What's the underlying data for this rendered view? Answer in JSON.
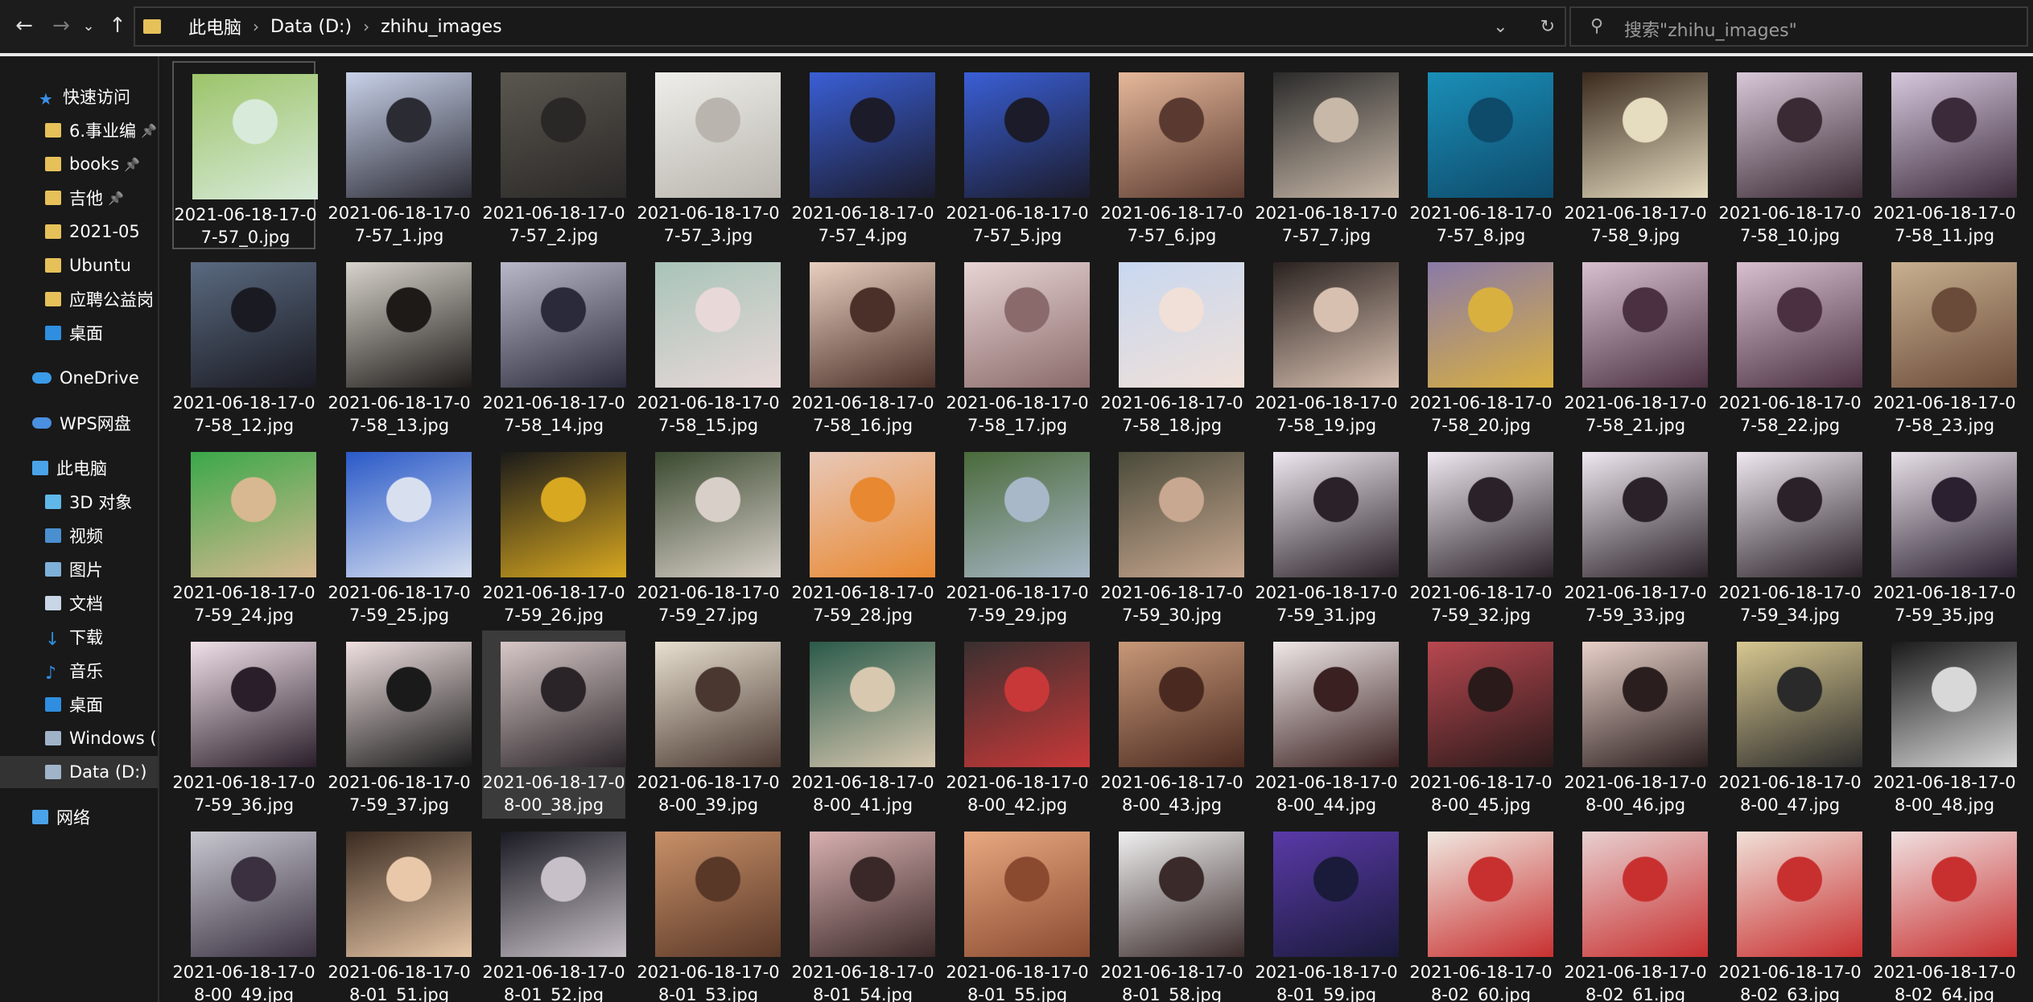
{
  "nav": {
    "back_icon": "arrow-left-icon",
    "forward_icon": "arrow-right-icon",
    "recent_icon": "chevron-down-icon",
    "up_icon": "arrow-up-icon"
  },
  "address": {
    "crumbs": [
      "此电脑",
      "Data (D:)",
      "zhihu_images"
    ],
    "dropdown_icon": "chevron-down-icon",
    "refresh_icon": "refresh-icon"
  },
  "search": {
    "placeholder": "搜索\"zhihu_images\"",
    "icon": "search-icon"
  },
  "sidebar": {
    "items": [
      {
        "label": "快速访问",
        "icon": "star-icon",
        "color": "#3a8ee6",
        "indent": 48,
        "pin": false
      },
      {
        "label": "6.事业编",
        "icon": "folder-icon",
        "color": "#e6c15a",
        "indent": 56,
        "pin": true
      },
      {
        "label": "books",
        "icon": "folder-icon",
        "color": "#e6c15a",
        "indent": 56,
        "pin": true
      },
      {
        "label": "吉他",
        "icon": "folder-icon",
        "color": "#e6c15a",
        "indent": 56,
        "pin": true
      },
      {
        "label": "2021-05",
        "icon": "folder-icon",
        "color": "#e6c15a",
        "indent": 56,
        "pin": false
      },
      {
        "label": "Ubuntu",
        "icon": "folder-icon",
        "color": "#e6c15a",
        "indent": 56,
        "pin": false
      },
      {
        "label": "应聘公益岗",
        "icon": "folder-icon",
        "color": "#e6c15a",
        "indent": 56,
        "pin": false
      },
      {
        "label": "桌面",
        "icon": "desktop-icon",
        "color": "#2f8ee0",
        "indent": 56,
        "pin": false
      },
      {
        "label": "OneDrive",
        "icon": "cloud-icon",
        "color": "#3a9be8",
        "indent": 40,
        "pin": false
      },
      {
        "label": "WPS网盘",
        "icon": "cloud-icon",
        "color": "#4a8fe0",
        "indent": 40,
        "pin": false
      },
      {
        "label": "此电脑",
        "icon": "computer-icon",
        "color": "#4aa3e8",
        "indent": 40,
        "pin": false
      },
      {
        "label": "3D 对象",
        "icon": "cube-icon",
        "color": "#5fb8e8",
        "indent": 56,
        "pin": false
      },
      {
        "label": "视频",
        "icon": "video-icon",
        "color": "#4a8fd0",
        "indent": 56,
        "pin": false
      },
      {
        "label": "图片",
        "icon": "picture-icon",
        "color": "#7fb0d8",
        "indent": 56,
        "pin": false
      },
      {
        "label": "文档",
        "icon": "document-icon",
        "color": "#c8d6e6",
        "indent": 56,
        "pin": false
      },
      {
        "label": "下载",
        "icon": "download-icon",
        "color": "#2f8ee0",
        "indent": 56,
        "pin": false
      },
      {
        "label": "音乐",
        "icon": "music-icon",
        "color": "#2f8ee0",
        "indent": 56,
        "pin": false
      },
      {
        "label": "桌面",
        "icon": "desktop-icon",
        "color": "#2f8ee0",
        "indent": 56,
        "pin": false
      },
      {
        "label": "Windows (",
        "icon": "drive-icon",
        "color": "#9fb4c8",
        "indent": 56,
        "pin": false
      },
      {
        "label": "Data (D:)",
        "icon": "drive-icon",
        "color": "#9fb4c8",
        "indent": 56,
        "pin": false
      },
      {
        "label": "网络",
        "icon": "network-icon",
        "color": "#4aa3e8",
        "indent": 40,
        "pin": false
      }
    ]
  },
  "files": [
    {
      "name": "2021-06-18-17-07-57_0.jpg",
      "c1": "#9cc46a",
      "c2": "#d8ead9"
    },
    {
      "name": "2021-06-18-17-07-57_1.jpg",
      "c1": "#c9d2ea",
      "c2": "#2b2b34"
    },
    {
      "name": "2021-06-18-17-07-57_2.jpg",
      "c1": "#5a5750",
      "c2": "#2a2826"
    },
    {
      "name": "2021-06-18-17-07-57_3.jpg",
      "c1": "#eeeeea",
      "c2": "#b9b5ae"
    },
    {
      "name": "2021-06-18-17-07-57_4.jpg",
      "c1": "#3a5fd6",
      "c2": "#1b1b2a"
    },
    {
      "name": "2021-06-18-17-07-57_5.jpg",
      "c1": "#3a5fd6",
      "c2": "#1b1b2a"
    },
    {
      "name": "2021-06-18-17-07-57_6.jpg",
      "c1": "#e6b89a",
      "c2": "#5a3a30"
    },
    {
      "name": "2021-06-18-17-07-57_7.jpg",
      "c1": "#2a2a2a",
      "c2": "#c8b8a8"
    },
    {
      "name": "2021-06-18-17-07-57_8.jpg",
      "c1": "#1a8fb8",
      "c2": "#0e4a6a"
    },
    {
      "name": "2021-06-18-17-07-58_9.jpg",
      "c1": "#3a2a1e",
      "c2": "#e6dcc0"
    },
    {
      "name": "2021-06-18-17-07-58_10.jpg",
      "c1": "#d8c8d8",
      "c2": "#3a2a34"
    },
    {
      "name": "2021-06-18-17-07-58_11.jpg",
      "c1": "#d8c8de",
      "c2": "#3a2a3a"
    },
    {
      "name": "2021-06-18-17-07-58_12.jpg",
      "c1": "#5a6a80",
      "c2": "#1a1a22"
    },
    {
      "name": "2021-06-18-17-07-58_13.jpg",
      "c1": "#d8d4cc",
      "c2": "#1e1a18"
    },
    {
      "name": "2021-06-18-17-07-58_14.jpg",
      "c1": "#b8b8c8",
      "c2": "#2a2a3a"
    },
    {
      "name": "2021-06-18-17-07-58_15.jpg",
      "c1": "#a8c4b8",
      "c2": "#e8d8d8"
    },
    {
      "name": "2021-06-18-17-07-58_16.jpg",
      "c1": "#e8d0c0",
      "c2": "#4a3028"
    },
    {
      "name": "2021-06-18-17-07-58_17.jpg",
      "c1": "#e8d4d4",
      "c2": "#8a6a6a"
    },
    {
      "name": "2021-06-18-17-07-58_18.jpg",
      "c1": "#c8d8f0",
      "c2": "#f0e0d8"
    },
    {
      "name": "2021-06-18-17-07-58_19.jpg",
      "c1": "#2a2220",
      "c2": "#d8c0b0"
    },
    {
      "name": "2021-06-18-17-07-58_20.jpg",
      "c1": "#8a7aa8",
      "c2": "#d8b040"
    },
    {
      "name": "2021-06-18-17-07-58_21.jpg",
      "c1": "#d8c0d0",
      "c2": "#4a3040"
    },
    {
      "name": "2021-06-18-17-07-58_22.jpg",
      "c1": "#d8c0d0",
      "c2": "#4a3040"
    },
    {
      "name": "2021-06-18-17-07-58_23.jpg",
      "c1": "#c8b090",
      "c2": "#6a4a38"
    },
    {
      "name": "2021-06-18-17-07-59_24.jpg",
      "c1": "#3aa84a",
      "c2": "#d8b890"
    },
    {
      "name": "2021-06-18-17-07-59_25.jpg",
      "c1": "#2a5ac8",
      "c2": "#d8e0f0"
    },
    {
      "name": "2021-06-18-17-07-59_26.jpg",
      "c1": "#1a1a1a",
      "c2": "#d8a820"
    },
    {
      "name": "2021-06-18-17-07-59_27.jpg",
      "c1": "#3a4a30",
      "c2": "#d8d0c8"
    },
    {
      "name": "2021-06-18-17-07-59_28.jpg",
      "c1": "#e8c8b8",
      "c2": "#e88830"
    },
    {
      "name": "2021-06-18-17-07-59_29.jpg",
      "c1": "#4a6a3a",
      "c2": "#a8b8c8"
    },
    {
      "name": "2021-06-18-17-07-59_30.jpg",
      "c1": "#4a4a3a",
      "c2": "#c8a890"
    },
    {
      "name": "2021-06-18-17-07-59_31.jpg",
      "c1": "#f0e8f0",
      "c2": "#2a2228"
    },
    {
      "name": "2021-06-18-17-07-59_32.jpg",
      "c1": "#f0e8f0",
      "c2": "#2a2228"
    },
    {
      "name": "2021-06-18-17-07-59_33.jpg",
      "c1": "#f0e8f0",
      "c2": "#2a2228"
    },
    {
      "name": "2021-06-18-17-07-59_34.jpg",
      "c1": "#f0e8f0",
      "c2": "#2a2228"
    },
    {
      "name": "2021-06-18-17-07-59_35.jpg",
      "c1": "#e8e0e8",
      "c2": "#2a2030"
    },
    {
      "name": "2021-06-18-17-07-59_36.jpg",
      "c1": "#f0e0e8",
      "c2": "#2a1e2a"
    },
    {
      "name": "2021-06-18-17-07-59_37.jpg",
      "c1": "#f0e0e0",
      "c2": "#1a1a1a"
    },
    {
      "name": "2021-06-18-17-08-00_38.jpg",
      "c1": "#d8c8c8",
      "c2": "#2a2428"
    },
    {
      "name": "2021-06-18-17-08-00_39.jpg",
      "c1": "#e8e0d0",
      "c2": "#4a3830"
    },
    {
      "name": "2021-06-18-17-08-00_41.jpg",
      "c1": "#2a5a4a",
      "c2": "#d8c8b0"
    },
    {
      "name": "2021-06-18-17-08-00_42.jpg",
      "c1": "#3a3030",
      "c2": "#c83838"
    },
    {
      "name": "2021-06-18-17-08-00_43.jpg",
      "c1": "#c89878",
      "c2": "#4a2a20"
    },
    {
      "name": "2021-06-18-17-08-00_44.jpg",
      "c1": "#f0e8e8",
      "c2": "#3a2020"
    },
    {
      "name": "2021-06-18-17-08-00_45.jpg",
      "c1": "#b84850",
      "c2": "#2a1a1a"
    },
    {
      "name": "2021-06-18-17-08-00_46.jpg",
      "c1": "#e8d0c8",
      "c2": "#2a1e1e"
    },
    {
      "name": "2021-06-18-17-08-00_47.jpg",
      "c1": "#d8c890",
      "c2": "#2a2a2a"
    },
    {
      "name": "2021-06-18-17-08-00_48.jpg",
      "c1": "#1a1a1a",
      "c2": "#d8d8d8"
    },
    {
      "name": "2021-06-18-17-08-00_49.jpg",
      "c1": "#c8c8d0",
      "c2": "#3a3040"
    },
    {
      "name": "2021-06-18-17-08-01_51.jpg",
      "c1": "#3a2a20",
      "c2": "#e8c8a8"
    },
    {
      "name": "2021-06-18-17-08-01_52.jpg",
      "c1": "#1a1a22",
      "c2": "#c8c0c8"
    },
    {
      "name": "2021-06-18-17-08-01_53.jpg",
      "c1": "#c89068",
      "c2": "#5a3828"
    },
    {
      "name": "2021-06-18-17-08-01_54.jpg",
      "c1": "#d8b0b0",
      "c2": "#3a2828"
    },
    {
      "name": "2021-06-18-17-08-01_55.jpg",
      "c1": "#e8a880",
      "c2": "#8a4a30"
    },
    {
      "name": "2021-06-18-17-08-01_58.jpg",
      "c1": "#f0f0f0",
      "c2": "#3a2a2a"
    },
    {
      "name": "2021-06-18-17-08-01_59.jpg",
      "c1": "#5a3aa8",
      "c2": "#1a1a3a"
    },
    {
      "name": "2021-06-18-17-08-02_60.jpg",
      "c1": "#f0e8e0",
      "c2": "#c83030"
    },
    {
      "name": "2021-06-18-17-08-02_61.jpg",
      "c1": "#e8d0d0",
      "c2": "#c83030"
    },
    {
      "name": "2021-06-18-17-08-02_63.jpg",
      "c1": "#f0e0d8",
      "c2": "#c83030"
    },
    {
      "name": "2021-06-18-17-08-02_64.jpg",
      "c1": "#f0e0e0",
      "c2": "#c83030"
    }
  ]
}
